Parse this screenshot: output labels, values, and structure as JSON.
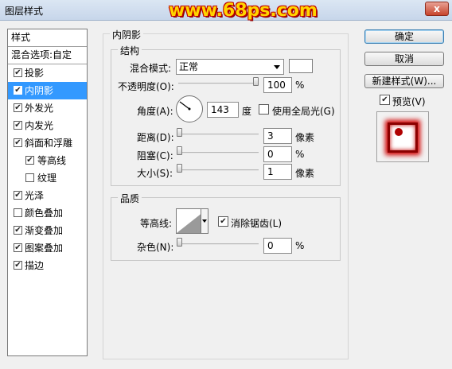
{
  "window": {
    "title": "图层样式",
    "watermark": "www.68ps.com",
    "close_glyph": "x"
  },
  "left_panel": {
    "header": "样式",
    "blend_options": "混合选项:自定",
    "items": [
      {
        "label": "投影",
        "checked": true
      },
      {
        "label": "内阴影",
        "checked": true,
        "selected": true
      },
      {
        "label": "外发光",
        "checked": true
      },
      {
        "label": "内发光",
        "checked": true
      },
      {
        "label": "斜面和浮雕",
        "checked": true
      },
      {
        "label": "等高线",
        "checked": true,
        "indent": true
      },
      {
        "label": "纹理",
        "checked": false,
        "indent": true
      },
      {
        "label": "光泽",
        "checked": true
      },
      {
        "label": "颜色叠加",
        "checked": false
      },
      {
        "label": "渐变叠加",
        "checked": true
      },
      {
        "label": "图案叠加",
        "checked": true
      },
      {
        "label": "描边",
        "checked": true
      }
    ]
  },
  "inner_shadow": {
    "title": "内阴影",
    "structure": {
      "legend": "结构",
      "blend_mode_label": "混合模式:",
      "blend_mode_value": "正常",
      "swatch_color": "#ffffff",
      "opacity_label": "不透明度(O):",
      "opacity_value": "100",
      "opacity_percent": 1.0,
      "percent_unit": "%",
      "angle_label": "角度(A):",
      "angle_value": "143",
      "angle_unit": "度",
      "global_light_label": "使用全局光(G)",
      "global_light_checked": false,
      "distance_label": "距离(D):",
      "distance_value": "3",
      "pixel_unit": "像素",
      "choke_label": "阻塞(C):",
      "choke_value": "0",
      "size_label": "大小(S):",
      "size_value": "1"
    },
    "quality": {
      "legend": "品质",
      "contour_label": "等高线:",
      "anti_alias_label": "消除锯齿(L)",
      "anti_alias_checked": true,
      "noise_label": "杂色(N):",
      "noise_value": "0"
    }
  },
  "buttons": {
    "ok": "确定",
    "cancel": "取消",
    "new_style": "新建样式(W)...",
    "preview_label": "预览(V)",
    "preview_checked": true
  },
  "colors": {
    "selection": "#3399ff",
    "preview_red": "#b00000"
  }
}
